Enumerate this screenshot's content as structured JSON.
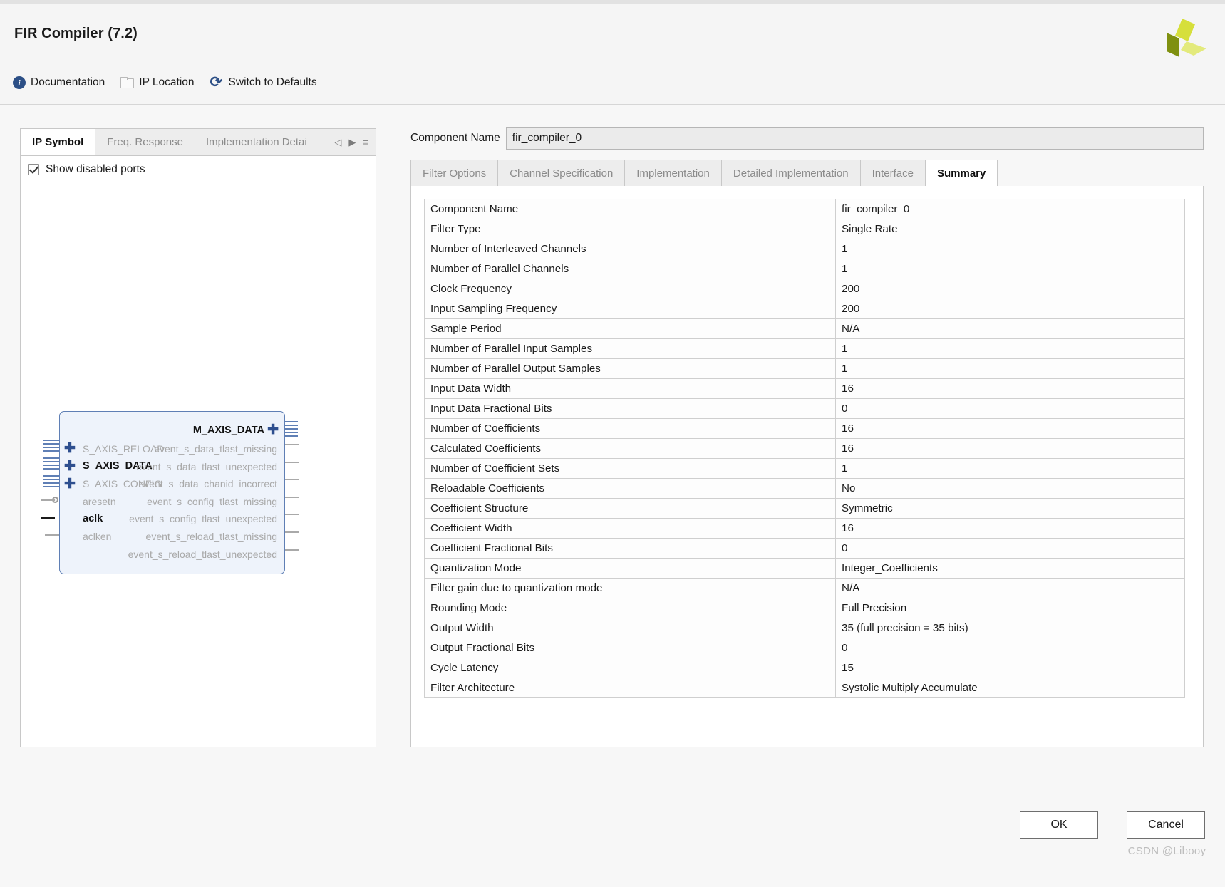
{
  "window": {
    "title": "FIR Compiler (7.2)",
    "logo_name": "xilinx-logo"
  },
  "toolbar": {
    "documentation": "Documentation",
    "ip_location": "IP Location",
    "switch_to_defaults": "Switch to Defaults"
  },
  "left_panel": {
    "tabs": [
      {
        "label": "IP Symbol",
        "active": true
      },
      {
        "label": "Freq. Response",
        "active": false
      },
      {
        "label": "Implementation Detai",
        "active": false
      }
    ],
    "scroll_left": "◁",
    "scroll_right": "▶",
    "menu": "≡",
    "show_disabled_ports": "Show disabled ports",
    "symbol": {
      "master_port": "M_AXIS_DATA",
      "slave_ports": [
        "S_AXIS_RELOAD",
        "S_AXIS_DATA",
        "S_AXIS_CONFIG"
      ],
      "clock_ports": [
        "aresetn",
        "aclk",
        "aclken"
      ],
      "event_ports": [
        "event_s_data_tlast_missing",
        "event_s_data_tlast_unexpected",
        "event_s_data_chanid_incorrect",
        "event_s_config_tlast_missing",
        "event_s_config_tlast_unexpected",
        "event_s_reload_tlast_missing",
        "event_s_reload_tlast_unexpected"
      ]
    }
  },
  "right_panel": {
    "component_name_label": "Component Name",
    "component_name_value": "fir_compiler_0",
    "tabs": [
      {
        "label": "Filter Options",
        "active": false
      },
      {
        "label": "Channel Specification",
        "active": false
      },
      {
        "label": "Implementation",
        "active": false
      },
      {
        "label": "Detailed Implementation",
        "active": false
      },
      {
        "label": "Interface",
        "active": false
      },
      {
        "label": "Summary",
        "active": true
      }
    ],
    "summary_rows": [
      {
        "key": "Component Name",
        "value": "fir_compiler_0"
      },
      {
        "key": "Filter Type",
        "value": "Single Rate"
      },
      {
        "key": "Number of Interleaved Channels",
        "value": "1"
      },
      {
        "key": "Number of Parallel Channels",
        "value": "1"
      },
      {
        "key": "Clock Frequency",
        "value": "200"
      },
      {
        "key": "Input Sampling Frequency",
        "value": "200"
      },
      {
        "key": "Sample Period",
        "value": "N/A"
      },
      {
        "key": "Number of Parallel Input Samples",
        "value": "1"
      },
      {
        "key": "Number of Parallel Output Samples",
        "value": "1"
      },
      {
        "key": "Input Data Width",
        "value": "16"
      },
      {
        "key": "Input Data Fractional Bits",
        "value": "0"
      },
      {
        "key": "Number of Coefficients",
        "value": "16"
      },
      {
        "key": "Calculated Coefficients",
        "value": "16"
      },
      {
        "key": "Number of Coefficient Sets",
        "value": "1"
      },
      {
        "key": "Reloadable Coefficients",
        "value": "No"
      },
      {
        "key": "Coefficient Structure",
        "value": "Symmetric"
      },
      {
        "key": "Coefficient Width",
        "value": "16"
      },
      {
        "key": "Coefficient Fractional Bits",
        "value": "0"
      },
      {
        "key": "Quantization Mode",
        "value": "Integer_Coefficients"
      },
      {
        "key": "Filter gain due to quantization mode",
        "value": "N/A"
      },
      {
        "key": "Rounding Mode",
        "value": "Full Precision"
      },
      {
        "key": "Output Width",
        "value": "35 (full precision = 35 bits)"
      },
      {
        "key": "Output Fractional Bits",
        "value": "0"
      },
      {
        "key": "Cycle Latency",
        "value": "15"
      },
      {
        "key": "Filter Architecture",
        "value": "Systolic Multiply Accumulate"
      }
    ]
  },
  "footer": {
    "ok": "OK",
    "cancel": "Cancel"
  },
  "watermark": "CSDN @Libooy_"
}
